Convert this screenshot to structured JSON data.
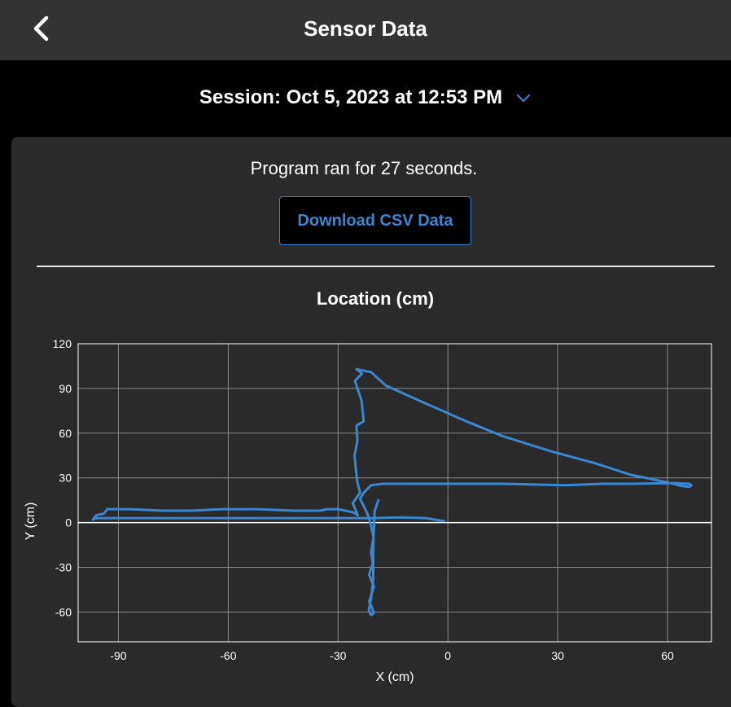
{
  "header": {
    "title": "Sensor Data",
    "back_icon": "chevron-left-icon"
  },
  "session": {
    "label": "Session: Oct 5, 2023 at 12:53 PM",
    "dropdown_icon": "chevron-down-icon"
  },
  "summary": {
    "run_text": "Program ran for 27 seconds."
  },
  "download_button": {
    "label": "Download CSV Data"
  },
  "colors": {
    "accent": "#3a86d1",
    "header_bg": "#333333",
    "panel_bg": "#2a2a2a",
    "page_bg": "#000000"
  },
  "chart_data": {
    "type": "line",
    "title": "Location (cm)",
    "xlabel": "X (cm)",
    "ylabel": "Y (cm)",
    "xlim": [
      -101,
      72
    ],
    "ylim": [
      -80,
      120
    ],
    "xticks": [
      -90,
      -60,
      -30,
      0,
      30,
      60
    ],
    "yticks": [
      -60,
      -30,
      0,
      30,
      60,
      90,
      120
    ],
    "grid": true,
    "series": [
      {
        "color": "#3a86d1",
        "x": [
          -1,
          -6,
          -13,
          -21,
          -35,
          -55,
          -80,
          -93,
          -96,
          -97,
          -96,
          -94,
          -93,
          -87,
          -78,
          -70,
          -62,
          -52,
          -42,
          -35,
          -33,
          -30,
          -26,
          -24.6,
          -26,
          -24,
          -24.8,
          -25.5,
          -24.7,
          -25,
          -23,
          -23.6,
          -25.4,
          -23.5,
          -25,
          -23.3,
          -21,
          -17,
          -8,
          5,
          15,
          28,
          40,
          50,
          60,
          64,
          66,
          66.5,
          66,
          62,
          50,
          42,
          32,
          15,
          5,
          0,
          -10,
          -18,
          -21,
          -23,
          -24,
          -22,
          -21.2,
          -20.3,
          -21,
          -20.5,
          -21.5,
          -20.2,
          -21.5,
          -20.6,
          -20.3,
          -21,
          -21.6,
          -21,
          -20.4,
          -20.4,
          -20.3,
          -20,
          -19
        ],
        "y": [
          1,
          3,
          3.5,
          3,
          3,
          3,
          3,
          3,
          3,
          2,
          5,
          6,
          9,
          9,
          8,
          8,
          9,
          9,
          8,
          8,
          9,
          9,
          7,
          5,
          13,
          20,
          28,
          45,
          55,
          65,
          68,
          82,
          95,
          100,
          103,
          102,
          101,
          92,
          82,
          68,
          58,
          48,
          40,
          32,
          27,
          24.5,
          24,
          25,
          26,
          26.5,
          26,
          26,
          25,
          26,
          26,
          26,
          26,
          26,
          25,
          20,
          16,
          6,
          0,
          -10,
          -20,
          -27,
          -35,
          -43,
          -53,
          -58,
          -61,
          -62,
          -59,
          -51,
          -38,
          -23,
          -8,
          8,
          15
        ]
      }
    ]
  }
}
